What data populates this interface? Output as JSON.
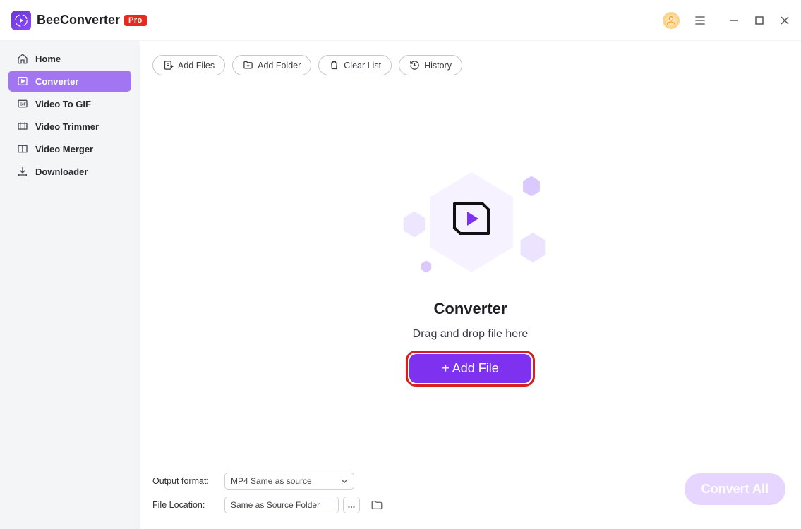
{
  "titlebar": {
    "brand": "BeeConverter",
    "pro_label": "Pro"
  },
  "sidebar": {
    "items": [
      {
        "label": "Home",
        "active": false
      },
      {
        "label": "Converter",
        "active": true
      },
      {
        "label": "Video To GIF",
        "active": false
      },
      {
        "label": "Video Trimmer",
        "active": false
      },
      {
        "label": "Video Merger",
        "active": false
      },
      {
        "label": "Downloader",
        "active": false
      }
    ]
  },
  "toolbar": {
    "add_files": "Add Files",
    "add_folder": "Add Folder",
    "clear_list": "Clear List",
    "history": "History"
  },
  "stage": {
    "title": "Converter",
    "subtitle": "Drag and drop file here",
    "add_file_btn": "+ Add File"
  },
  "bottom": {
    "output_label": "Output format:",
    "output_value": "MP4 Same as source",
    "location_label": "File Location:",
    "location_value": "Same as Source Folder",
    "dots": "...",
    "convert_all": "Convert All"
  }
}
